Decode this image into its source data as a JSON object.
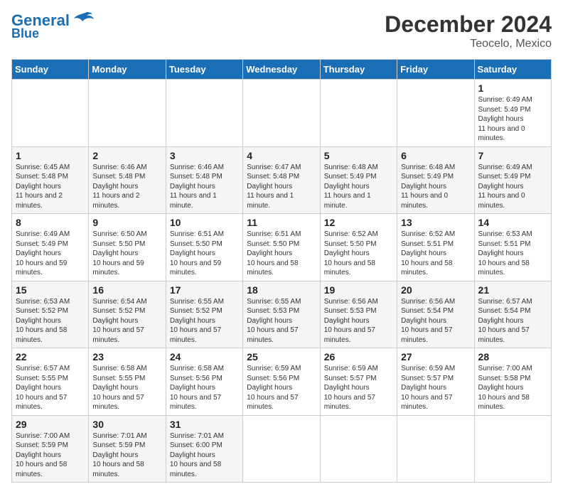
{
  "header": {
    "logo_line1": "General",
    "logo_line2": "Blue",
    "title": "December 2024",
    "subtitle": "Teocelo, Mexico"
  },
  "calendar": {
    "days_of_week": [
      "Sunday",
      "Monday",
      "Tuesday",
      "Wednesday",
      "Thursday",
      "Friday",
      "Saturday"
    ],
    "weeks": [
      [
        null,
        null,
        null,
        null,
        null,
        null,
        {
          "day": 1,
          "sunrise": "6:49 AM",
          "sunset": "5:49 PM",
          "daylight": "11 hours and 0 minutes."
        }
      ],
      [
        {
          "day": 1,
          "sunrise": "6:45 AM",
          "sunset": "5:48 PM",
          "daylight": "11 hours and 2 minutes."
        },
        {
          "day": 2,
          "sunrise": "6:46 AM",
          "sunset": "5:48 PM",
          "daylight": "11 hours and 2 minutes."
        },
        {
          "day": 3,
          "sunrise": "6:46 AM",
          "sunset": "5:48 PM",
          "daylight": "11 hours and 1 minute."
        },
        {
          "day": 4,
          "sunrise": "6:47 AM",
          "sunset": "5:48 PM",
          "daylight": "11 hours and 1 minute."
        },
        {
          "day": 5,
          "sunrise": "6:48 AM",
          "sunset": "5:49 PM",
          "daylight": "11 hours and 1 minute."
        },
        {
          "day": 6,
          "sunrise": "6:48 AM",
          "sunset": "5:49 PM",
          "daylight": "11 hours and 0 minutes."
        },
        {
          "day": 7,
          "sunrise": "6:49 AM",
          "sunset": "5:49 PM",
          "daylight": "11 hours and 0 minutes."
        }
      ],
      [
        {
          "day": 8,
          "sunrise": "6:49 AM",
          "sunset": "5:49 PM",
          "daylight": "10 hours and 59 minutes."
        },
        {
          "day": 9,
          "sunrise": "6:50 AM",
          "sunset": "5:50 PM",
          "daylight": "10 hours and 59 minutes."
        },
        {
          "day": 10,
          "sunrise": "6:51 AM",
          "sunset": "5:50 PM",
          "daylight": "10 hours and 59 minutes."
        },
        {
          "day": 11,
          "sunrise": "6:51 AM",
          "sunset": "5:50 PM",
          "daylight": "10 hours and 58 minutes."
        },
        {
          "day": 12,
          "sunrise": "6:52 AM",
          "sunset": "5:50 PM",
          "daylight": "10 hours and 58 minutes."
        },
        {
          "day": 13,
          "sunrise": "6:52 AM",
          "sunset": "5:51 PM",
          "daylight": "10 hours and 58 minutes."
        },
        {
          "day": 14,
          "sunrise": "6:53 AM",
          "sunset": "5:51 PM",
          "daylight": "10 hours and 58 minutes."
        }
      ],
      [
        {
          "day": 15,
          "sunrise": "6:53 AM",
          "sunset": "5:52 PM",
          "daylight": "10 hours and 58 minutes."
        },
        {
          "day": 16,
          "sunrise": "6:54 AM",
          "sunset": "5:52 PM",
          "daylight": "10 hours and 57 minutes."
        },
        {
          "day": 17,
          "sunrise": "6:55 AM",
          "sunset": "5:52 PM",
          "daylight": "10 hours and 57 minutes."
        },
        {
          "day": 18,
          "sunrise": "6:55 AM",
          "sunset": "5:53 PM",
          "daylight": "10 hours and 57 minutes."
        },
        {
          "day": 19,
          "sunrise": "6:56 AM",
          "sunset": "5:53 PM",
          "daylight": "10 hours and 57 minutes."
        },
        {
          "day": 20,
          "sunrise": "6:56 AM",
          "sunset": "5:54 PM",
          "daylight": "10 hours and 57 minutes."
        },
        {
          "day": 21,
          "sunrise": "6:57 AM",
          "sunset": "5:54 PM",
          "daylight": "10 hours and 57 minutes."
        }
      ],
      [
        {
          "day": 22,
          "sunrise": "6:57 AM",
          "sunset": "5:55 PM",
          "daylight": "10 hours and 57 minutes."
        },
        {
          "day": 23,
          "sunrise": "6:58 AM",
          "sunset": "5:55 PM",
          "daylight": "10 hours and 57 minutes."
        },
        {
          "day": 24,
          "sunrise": "6:58 AM",
          "sunset": "5:56 PM",
          "daylight": "10 hours and 57 minutes."
        },
        {
          "day": 25,
          "sunrise": "6:59 AM",
          "sunset": "5:56 PM",
          "daylight": "10 hours and 57 minutes."
        },
        {
          "day": 26,
          "sunrise": "6:59 AM",
          "sunset": "5:57 PM",
          "daylight": "10 hours and 57 minutes."
        },
        {
          "day": 27,
          "sunrise": "6:59 AM",
          "sunset": "5:57 PM",
          "daylight": "10 hours and 57 minutes."
        },
        {
          "day": 28,
          "sunrise": "7:00 AM",
          "sunset": "5:58 PM",
          "daylight": "10 hours and 58 minutes."
        }
      ],
      [
        {
          "day": 29,
          "sunrise": "7:00 AM",
          "sunset": "5:59 PM",
          "daylight": "10 hours and 58 minutes."
        },
        {
          "day": 30,
          "sunrise": "7:01 AM",
          "sunset": "5:59 PM",
          "daylight": "10 hours and 58 minutes."
        },
        {
          "day": 31,
          "sunrise": "7:01 AM",
          "sunset": "6:00 PM",
          "daylight": "10 hours and 58 minutes."
        },
        null,
        null,
        null,
        null
      ]
    ]
  }
}
